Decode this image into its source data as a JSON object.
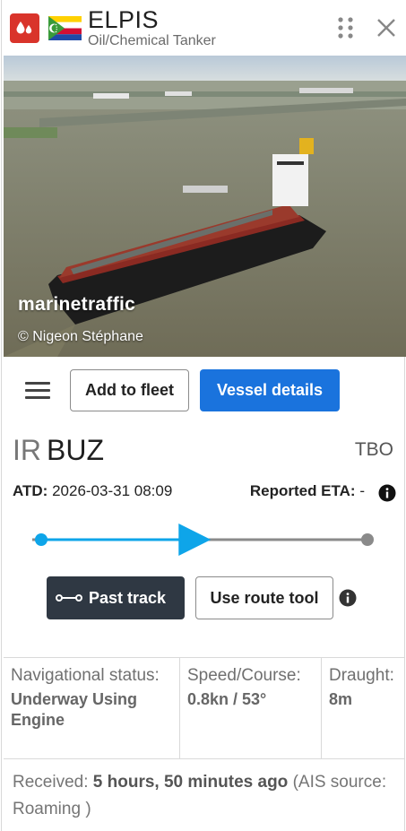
{
  "vessel": {
    "name": "ELPIS",
    "type": "Oil/Chemical Tanker",
    "type_icon": "tanker-drop-icon",
    "flag": "comoros-flag"
  },
  "photo": {
    "watermark": "marinetraffic",
    "credit": "© Nigeon Stéphane"
  },
  "toolbar": {
    "add_fleet_label": "Add to fleet",
    "vessel_details_label": "Vessel details"
  },
  "route": {
    "departure_country": "IR",
    "departure_port": "BUZ",
    "destination": "TBO",
    "atd_label": "ATD:",
    "atd_value": "2026-03-31 08:09",
    "eta_label": "Reported ETA:",
    "eta_value": "-",
    "progress_fraction": 0.52
  },
  "actions": {
    "past_track_label": "Past track",
    "route_tool_label": "Use route tool"
  },
  "info": {
    "nav_status_label": "Navigational status:",
    "nav_status_value": "Underway Using Engine",
    "speed_label": "Speed/Course:",
    "speed_value": "0.8kn / 53°",
    "draught_label": "Draught:",
    "draught_value": "8m"
  },
  "received": {
    "prefix": "Received:",
    "time": "5 hours, 50 minutes ago",
    "source_prefix": "(AIS source:",
    "source_value": "Roaming )"
  },
  "colors": {
    "accent": "#1a73dd",
    "track_done": "#0ea5e9",
    "track_button": "#2f3843",
    "type_badge": "#d9342b"
  }
}
